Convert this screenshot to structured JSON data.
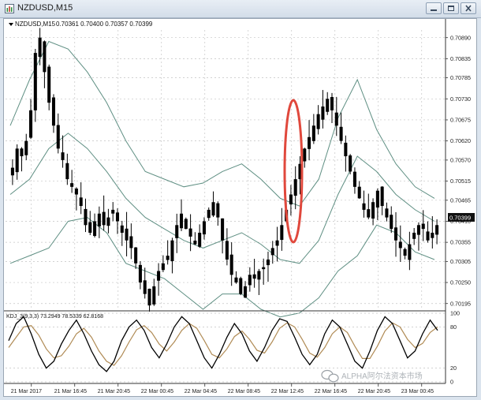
{
  "window": {
    "title": "NZDUSD,M15"
  },
  "chart_header": {
    "symbol_label": "NZDUSD,M15",
    "ohlc": "0.70361 0.70400 0.70357 0.70399"
  },
  "price_axis": {
    "labels": [
      "0.70890",
      "0.70835",
      "0.70785",
      "0.70730",
      "0.70675",
      "0.70620",
      "0.70570",
      "0.70515",
      "0.70465",
      "0.70410",
      "0.70355",
      "0.70305",
      "0.70250",
      "0.70195"
    ],
    "current_price": "0.70399",
    "current_price_color": "#111111"
  },
  "indicator": {
    "label": "KDJ_3(9,3,3) 73.2949 78.5339 62.8168",
    "levels": [
      "100",
      "80",
      "20",
      "0"
    ]
  },
  "time_axis": {
    "labels": [
      "21 Mar 2017",
      "21 Mar 16:45",
      "21 Mar 20:45",
      "22 Mar 00:45",
      "22 Mar 04:45",
      "22 Mar 08:45",
      "22 Mar 12:45",
      "22 Mar 16:45",
      "22 Mar 20:45",
      "23 Mar 00:45"
    ]
  },
  "watermark": "ALPHA阿尔法资本市场",
  "colors": {
    "bollinger": "#5f8f83",
    "candles": "#000000",
    "highlight": "#e0483c",
    "kdj_k": "#000000",
    "kdj_d": "#b08b55"
  },
  "icons": {
    "app": "chart-window-icon",
    "minimize": "minimize-icon",
    "restore": "restore-icon",
    "close": "close-icon",
    "watermark": "wechat-icon"
  },
  "chart_data": {
    "type": "candlestick",
    "x": [
      "21 Mar 2017",
      "21 Mar 16:45",
      "21 Mar 20:45",
      "22 Mar 00:45",
      "22 Mar 04:45",
      "22 Mar 08:45",
      "22 Mar 12:45",
      "22 Mar 16:45",
      "22 Mar 20:45",
      "23 Mar 00:45"
    ],
    "close_series": [
      0.7055,
      0.706,
      0.7058,
      0.7062,
      0.707,
      0.7085,
      0.7089,
      0.708,
      0.7072,
      0.7066,
      0.706,
      0.7057,
      0.7052,
      0.705,
      0.7048,
      0.7045,
      0.704,
      0.7038,
      0.7041,
      0.7043,
      0.704,
      0.7042,
      0.7044,
      0.7041,
      0.7038,
      0.7036,
      0.7034,
      0.703,
      0.7025,
      0.7022,
      0.7019,
      0.7024,
      0.7028,
      0.703,
      0.7032,
      0.7036,
      0.704,
      0.7043,
      0.7039,
      0.7037,
      0.7035,
      0.7038,
      0.7041,
      0.7044,
      0.7046,
      0.7042,
      0.7036,
      0.7031,
      0.7027,
      0.7025,
      0.7022,
      0.7024,
      0.7027,
      0.7026,
      0.7028,
      0.7029,
      0.7031,
      0.7034,
      0.7036,
      0.704,
      0.7044,
      0.7048,
      0.7052,
      0.7056,
      0.706,
      0.7063,
      0.7066,
      0.7069,
      0.7071,
      0.7073,
      0.707,
      0.7066,
      0.7062,
      0.7058,
      0.7054,
      0.705,
      0.7047,
      0.7044,
      0.7042,
      0.7046,
      0.7049,
      0.7045,
      0.7042,
      0.7039,
      0.7036,
      0.7034,
      0.7032,
      0.7035,
      0.7038,
      0.704,
      0.7039,
      0.7036,
      0.7038,
      0.704
    ],
    "bollinger_upper": [
      0.7066,
      0.7078,
      0.7088,
      0.7086,
      0.708,
      0.7072,
      0.7062,
      0.7054,
      0.7052,
      0.705,
      0.7051,
      0.7054,
      0.7056,
      0.7052,
      0.7047,
      0.7045,
      0.7052,
      0.7068,
      0.7078,
      0.7065,
      0.7056,
      0.705,
      0.7047
    ],
    "bollinger_middle": [
      0.7048,
      0.7052,
      0.706,
      0.7064,
      0.706,
      0.7054,
      0.7047,
      0.7042,
      0.7039,
      0.7036,
      0.7034,
      0.7036,
      0.7038,
      0.7035,
      0.7031,
      0.703,
      0.7036,
      0.7048,
      0.7058,
      0.7054,
      0.7048,
      0.7044,
      0.7041
    ],
    "bollinger_lower": [
      0.703,
      0.7032,
      0.7034,
      0.7041,
      0.7042,
      0.7038,
      0.703,
      0.7028,
      0.7026,
      0.7022,
      0.7018,
      0.7022,
      0.7022,
      0.7018,
      0.7016,
      0.7017,
      0.7021,
      0.7028,
      0.7032,
      0.704,
      0.7038,
      0.7033,
      0.7031
    ],
    "ylim": [
      0.7018,
      0.7091
    ],
    "kdj_k": [
      60,
      85,
      95,
      70,
      40,
      20,
      30,
      55,
      75,
      90,
      70,
      45,
      25,
      15,
      30,
      60,
      80,
      90,
      75,
      50,
      35,
      55,
      80,
      95,
      85,
      60,
      35,
      20,
      40,
      65,
      85,
      70,
      45,
      30,
      50,
      75,
      92,
      88,
      65,
      40,
      25,
      40,
      70,
      90,
      80,
      55,
      30,
      20,
      45,
      75,
      95,
      85,
      60,
      35,
      45,
      70,
      90,
      75
    ],
    "kdj_d": [
      50,
      65,
      80,
      82,
      68,
      48,
      35,
      38,
      52,
      70,
      78,
      65,
      45,
      30,
      24,
      38,
      58,
      76,
      82,
      72,
      55,
      45,
      58,
      75,
      85,
      78,
      60,
      40,
      35,
      48,
      66,
      74,
      62,
      46,
      42,
      58,
      78,
      86,
      80,
      62,
      42,
      36,
      50,
      70,
      80,
      72,
      52,
      34,
      34,
      52,
      74,
      86,
      80,
      62,
      50,
      56,
      72,
      80
    ],
    "ylim_kdj": [
      0,
      100
    ]
  }
}
